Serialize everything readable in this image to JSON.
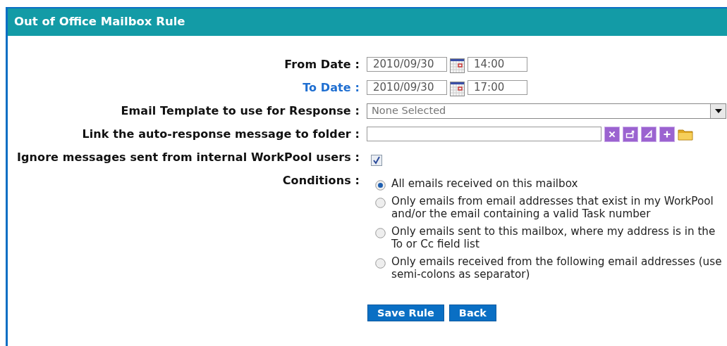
{
  "window": {
    "title": "Out of Office Mailbox Rule"
  },
  "rows": [
    {
      "kind": "date",
      "label": "From Date :",
      "highlighted": false,
      "date": "2010/09/30",
      "time": "14:00"
    },
    {
      "kind": "date",
      "label": "To Date :",
      "highlighted": true,
      "date": "2010/09/30",
      "time": "17:00"
    },
    {
      "kind": "select",
      "label": "Email Template to use for Response :",
      "value": "None Selected"
    },
    {
      "kind": "folder",
      "label": "Link the auto-response message to folder :"
    },
    {
      "kind": "checkbox",
      "label": "Ignore messages sent from internal WorkPool users :",
      "checked": true
    },
    {
      "kind": "radios",
      "label": "Conditions :",
      "options": [
        {
          "text": "All emails received on this mailbox",
          "selected": true
        },
        {
          "text": "Only emails from email addresses that exist in my WorkPool and/or the email containing a valid Task number",
          "selected": false
        },
        {
          "text": "Only emails sent to this mailbox, where my address is in the To or Cc field list",
          "selected": false
        },
        {
          "text": "Only emails received from the following email addresses (use semi-colons as separator)",
          "selected": false
        }
      ]
    }
  ],
  "buttons": [
    "Save Rule",
    "Back"
  ]
}
